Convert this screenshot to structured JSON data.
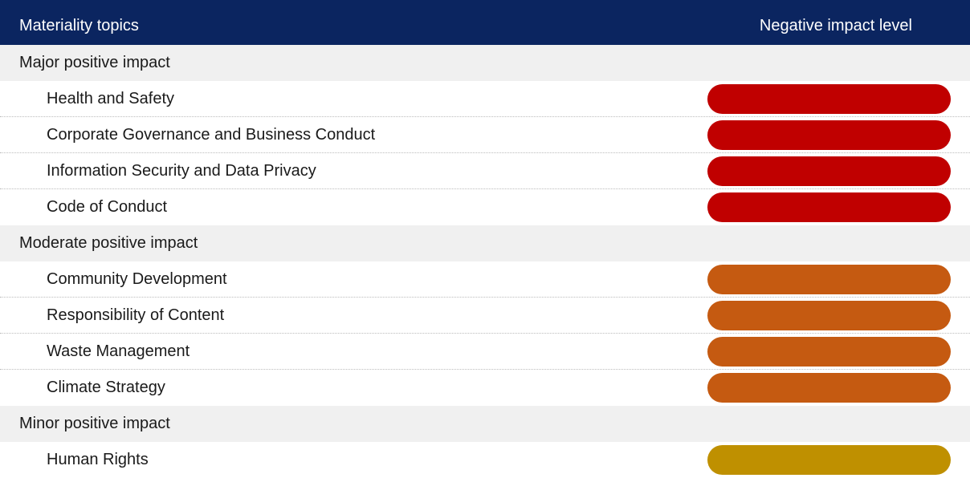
{
  "header": {
    "left_label": "Materiality topics",
    "right_label": "Negative impact level"
  },
  "colors": {
    "header_bg": "#0b2560",
    "group_bg": "#f0f0f0",
    "major": "#c00000",
    "moderate": "#c55a11",
    "minor": "#bf9000"
  },
  "groups": [
    {
      "label": "Major positive impact",
      "level": "major",
      "items": [
        {
          "label": "Health and Safety"
        },
        {
          "label": "Corporate Governance and Business Conduct"
        },
        {
          "label": "Information Security and Data Privacy"
        },
        {
          "label": "Code of Conduct"
        }
      ]
    },
    {
      "label": "Moderate positive impact",
      "level": "moderate",
      "items": [
        {
          "label": "Community Development"
        },
        {
          "label": "Responsibility of Content"
        },
        {
          "label": "Waste Management"
        },
        {
          "label": "Climate Strategy"
        }
      ]
    },
    {
      "label": "Minor positive impact",
      "level": "minor",
      "items": [
        {
          "label": "Human Rights"
        }
      ]
    }
  ]
}
